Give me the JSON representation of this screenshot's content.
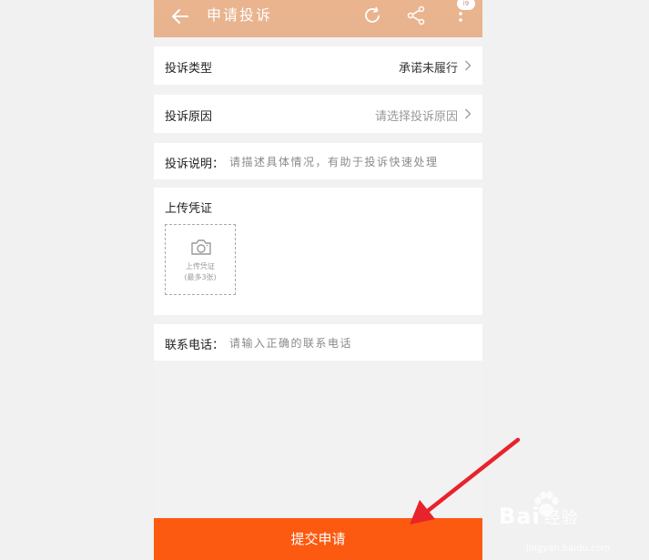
{
  "header": {
    "title": "申请投诉",
    "badge": "i9"
  },
  "form": {
    "complaint_type": {
      "label": "投诉类型",
      "value": "承诺未履行"
    },
    "complaint_reason": {
      "label": "投诉原因",
      "value": "请选择投诉原因"
    },
    "description": {
      "label": "投诉说明：",
      "placeholder": "请描述具体情况，有助于投诉快速处理"
    },
    "upload": {
      "label": "上传凭证",
      "box_line1": "上传凭证",
      "box_line2": "(最多3张)"
    },
    "phone": {
      "label": "联系电话：",
      "placeholder": "请输入正确的联系电话"
    }
  },
  "submit_label": "提交申请",
  "watermark": {
    "logo": "Bai",
    "logo_tail": "经验",
    "url": "jingyan.baidu.com"
  },
  "colors": {
    "header": "#e8b38f",
    "submit": "#fc5a10",
    "arrow": "#e8232b"
  }
}
